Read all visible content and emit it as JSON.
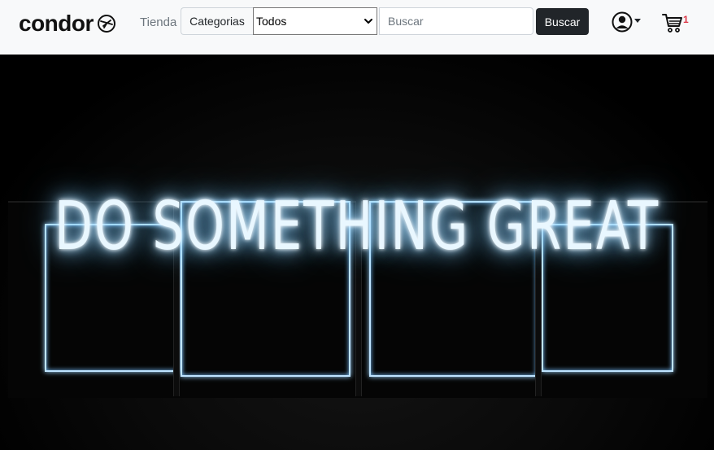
{
  "navbar": {
    "brand": "condor",
    "brand_icon": "plane-icon",
    "nav_link": "Tienda",
    "search": {
      "category_label": "Categorias",
      "category_selected": "Todos",
      "placeholder": "Buscar",
      "button_label": "Buscar"
    },
    "user_icon": "user-circle-icon",
    "cart": {
      "icon": "cart-icon",
      "count": "1"
    }
  },
  "hero": {
    "neon_text": "DO SOMETHING GREAT"
  },
  "colors": {
    "navbar_bg": "#f8f9fa",
    "button_bg": "#212529",
    "cart_badge": "#dc3545",
    "neon_glow": "#8fd2ff"
  }
}
